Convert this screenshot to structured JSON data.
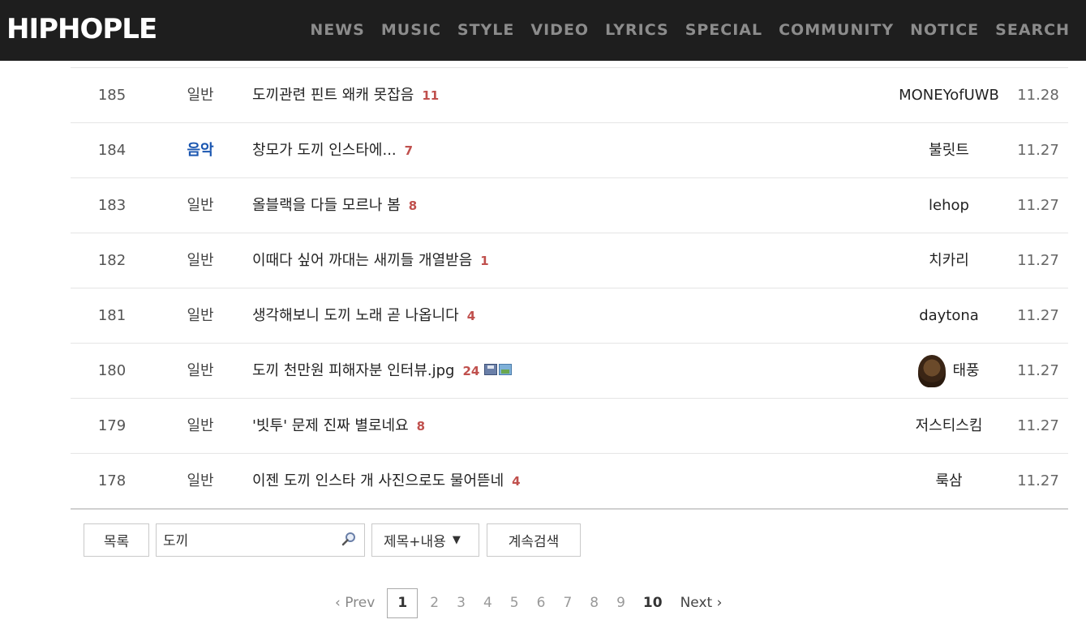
{
  "brand": {
    "logo": "HIPHOPLE"
  },
  "nav": [
    "NEWS",
    "MUSIC",
    "STYLE",
    "VIDEO",
    "LYRICS",
    "SPECIAL",
    "COMMUNITY",
    "NOTICE",
    "SEARCH"
  ],
  "rows": [
    {
      "no": "185",
      "category": "일반",
      "title": "도끼관련 핀트 왜캐 못잡음",
      "replies": "11",
      "author": "MONEYofUWB",
      "date": "11.28"
    },
    {
      "no": "184",
      "category": "음악",
      "title": "창모가 도끼 인스타에...",
      "replies": "7",
      "author": "불릿트",
      "date": "11.27"
    },
    {
      "no": "183",
      "category": "일반",
      "title": "올블랙을 다들 모르나 봄",
      "replies": "8",
      "author": "lehop",
      "date": "11.27"
    },
    {
      "no": "182",
      "category": "일반",
      "title": "이때다 싶어 까대는 새끼들 개열받음",
      "replies": "1",
      "author": "치카리",
      "date": "11.27"
    },
    {
      "no": "181",
      "category": "일반",
      "title": "생각해보니 도끼 노래 곧 나옵니다",
      "replies": "4",
      "author": "daytona",
      "date": "11.27"
    },
    {
      "no": "180",
      "category": "일반",
      "title": "도끼 천만원 피해자분 인터뷰.jpg",
      "replies": "24",
      "author": "태풍",
      "date": "11.27"
    },
    {
      "no": "179",
      "category": "일반",
      "title": "'빗투' 문제 진짜 별로네요",
      "replies": "8",
      "author": "저스티스킴",
      "date": "11.27"
    },
    {
      "no": "178",
      "category": "일반",
      "title": "이젠 도끼 인스타 개 사진으로도 물어뜯네",
      "replies": "4",
      "author": "룩삼",
      "date": "11.27"
    }
  ],
  "toolbar": {
    "list_label": "목록",
    "search_value": "도끼",
    "select_label": "제목+내용",
    "select_arrow": "▼",
    "continue_label": "계속검색"
  },
  "pager": {
    "prev": "‹ Prev",
    "pages": [
      "1",
      "2",
      "3",
      "4",
      "5",
      "6",
      "7",
      "8",
      "9",
      "10"
    ],
    "current": "1",
    "next": "Next ›"
  }
}
